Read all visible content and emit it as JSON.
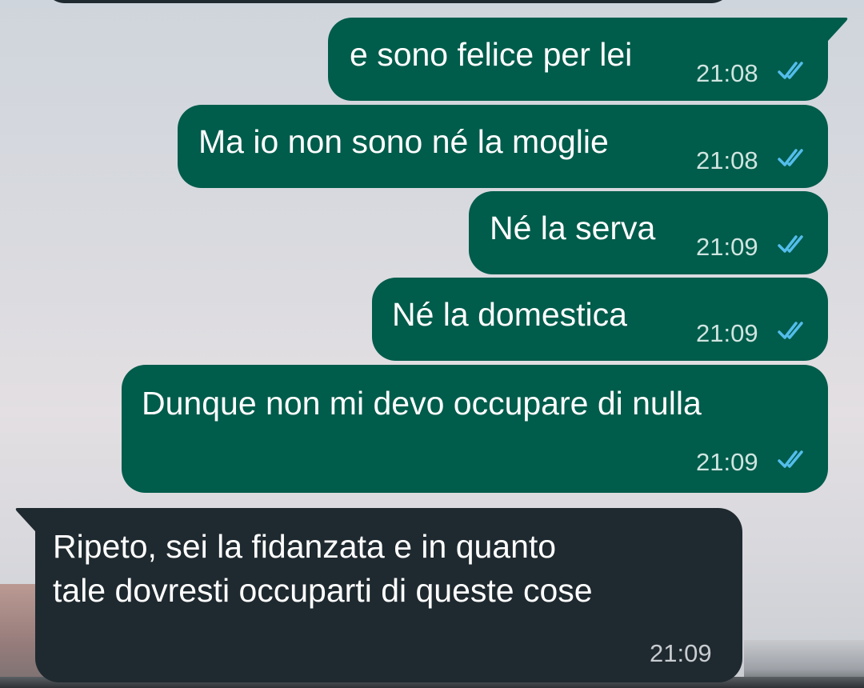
{
  "colors": {
    "outgoing_bubble": "#005c4b",
    "incoming_bubble": "#1f2a30",
    "read_ticks": "#53bdeb",
    "text": "#ffffff"
  },
  "messages": [
    {
      "direction": "outgoing",
      "text": "e sono felice per lei",
      "time": "21:08",
      "status": "read"
    },
    {
      "direction": "outgoing",
      "text": "Ma io non sono né la moglie",
      "time": "21:08",
      "status": "read"
    },
    {
      "direction": "outgoing",
      "text": "Né la serva",
      "time": "21:09",
      "status": "read"
    },
    {
      "direction": "outgoing",
      "text": "Né la domestica",
      "time": "21:09",
      "status": "read"
    },
    {
      "direction": "outgoing",
      "text": "Dunque non mi devo occupare di nulla",
      "time": "21:09",
      "status": "read"
    },
    {
      "direction": "incoming",
      "text_lines": [
        "Ripeto, sei la fidanzata e in quanto",
        "tale dovresti occuparti di queste cose"
      ],
      "time": "21:09"
    }
  ]
}
